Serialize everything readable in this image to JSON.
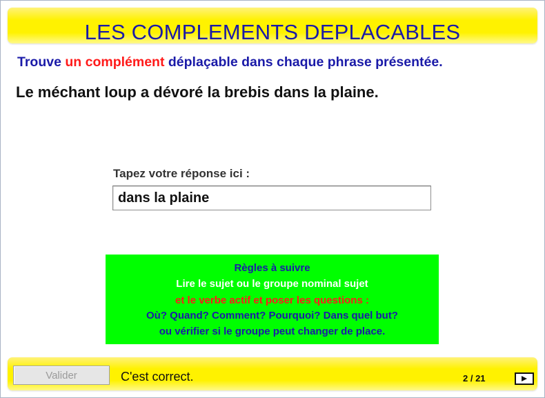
{
  "header": {
    "title": "LES COMPLEMENTS DEPLACABLES"
  },
  "instruction": {
    "part1": "Trouve ",
    "part2_highlight": "un complément",
    "part3": " déplaçable dans chaque phrase présentée."
  },
  "question": {
    "sentence": "Le méchant loup a dévoré la brebis dans la plaine."
  },
  "answer": {
    "label": "Tapez votre réponse ici :",
    "value": "dans la plaine"
  },
  "rules": {
    "title": "Règles à suivre",
    "line1": "Lire le sujet ou le groupe nominal sujet",
    "line2": "et le verbe actif et poser les questions :",
    "line3": "Où? Quand? Comment? Pourquoi? Dans quel but?",
    "line4": "ou vérifier si le groupe peut changer de place."
  },
  "footer": {
    "validate_label": "Valider",
    "feedback": "C'est correct.",
    "page_counter": "2 / 21",
    "next_icon": "play-icon"
  },
  "colors": {
    "banner_yellow": "#fff200",
    "title_blue": "#1a1aa8",
    "highlight_red": "#ff1a1a",
    "rules_green": "#00ff00"
  }
}
